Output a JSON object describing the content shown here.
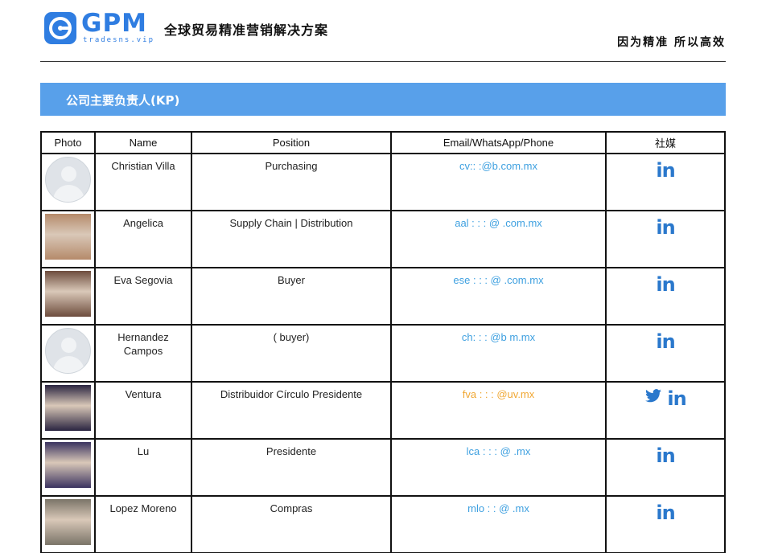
{
  "header": {
    "logo_text": "GPM",
    "logo_sub": "tradesns.vip",
    "tagline": "全球贸易精准营销解决方案",
    "motto": "因为精准 所以高效"
  },
  "section": {
    "title": "公司主要负责人(KP)"
  },
  "table": {
    "headers": [
      "Photo",
      "Name",
      "Position",
      "Email/WhatsApp/Phone",
      "社媒"
    ],
    "rows": [
      {
        "photo": "placeholder-avatar",
        "name": "Christian Villa",
        "position": "Purchasing",
        "contact": "cv:: :@b.com.mx",
        "contact_color": "#3ea0e0",
        "social": [
          "linkedin-icon"
        ],
        "linkedin": "in"
      },
      {
        "photo": "person-photo",
        "name": "Angelica",
        "position": "Supply Chain | Distribution",
        "contact": "aal : : : @ .com.mx",
        "contact_color": "#3ea0e0",
        "social": [
          "linkedin-icon"
        ],
        "linkedin": "in"
      },
      {
        "photo": "person-photo",
        "name": "Eva Segovia",
        "position": "Buyer",
        "contact": "ese : : : @ .com.mx",
        "contact_color": "#3ea0e0",
        "social": [
          "linkedin-icon"
        ],
        "linkedin": "in"
      },
      {
        "photo": "placeholder-avatar",
        "name": "Hernandez Campos",
        "position": "( buyer)",
        "contact": "ch: : : @b m.mx",
        "contact_color": "#3ea0e0",
        "social": [
          "linkedin-icon"
        ],
        "linkedin": "in"
      },
      {
        "photo": "person-photo",
        "name": "Ventura",
        "position": "Distribuidor Círculo Presidente",
        "contact": "fva : : : @uv.mx",
        "contact_color": "#f0a733",
        "social": [
          "twitter-icon",
          "linkedin-icon"
        ],
        "linkedin": "in"
      },
      {
        "photo": "person-photo",
        "name": "Lu",
        "position": "Presidente",
        "contact": "lca : : : @ .mx",
        "contact_color": "#3ea0e0",
        "social": [
          "linkedin-icon"
        ],
        "linkedin": "in"
      },
      {
        "photo": "person-photo",
        "name": "Lopez Moreno",
        "position": "Compras",
        "contact": "mlo : : @ .mx",
        "contact_color": "#3ea0e0",
        "social": [
          "linkedin-icon"
        ],
        "linkedin": "in"
      }
    ]
  }
}
